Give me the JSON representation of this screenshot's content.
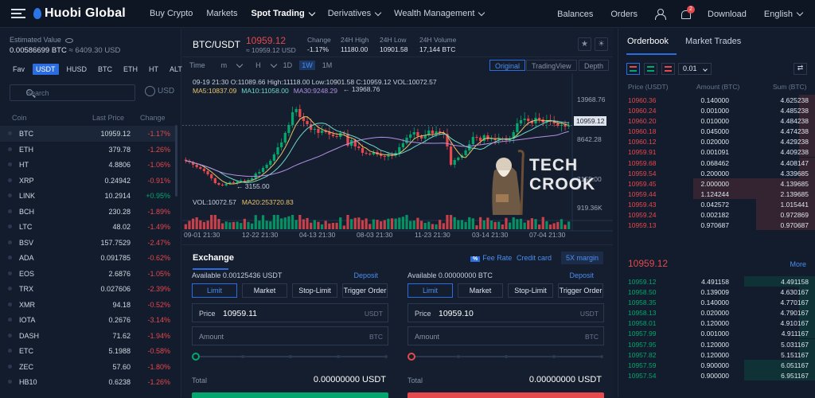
{
  "topnav": {
    "logo": "Huobi Global",
    "items": [
      "Buy Crypto",
      "Markets",
      "Spot Trading",
      "Derivatives",
      "Wealth Management"
    ],
    "active_item": "Spot Trading",
    "right_items": {
      "balances": "Balances",
      "orders": "Orders",
      "download": "Download",
      "language": "English"
    },
    "notification_count": "2"
  },
  "sidebar": {
    "est_label": "Estimated Value",
    "est_btc": "0.00586699 BTC",
    "est_usd": "≈ 6409.30 USD",
    "tabs": [
      "Fav",
      "USDT",
      "HUSD",
      "BTC",
      "ETH",
      "HT",
      "ALTS"
    ],
    "active_tab": "USDT",
    "search_placeholder": "Search",
    "currency_toggle": "USD",
    "columns": {
      "coin": "Coin",
      "last_price": "Last Price",
      "change": "Change"
    },
    "coins": [
      {
        "coin": "BTC",
        "price": "10959.12",
        "change": "-1.17%",
        "dir": "neg"
      },
      {
        "coin": "ETH",
        "price": "379.78",
        "change": "-1.26%",
        "dir": "neg"
      },
      {
        "coin": "HT",
        "price": "4.8806",
        "change": "-1.06%",
        "dir": "neg"
      },
      {
        "coin": "XRP",
        "price": "0.24942",
        "change": "-0.91%",
        "dir": "neg"
      },
      {
        "coin": "LINK",
        "price": "10.2914",
        "change": "+0.95%",
        "dir": "pos"
      },
      {
        "coin": "BCH",
        "price": "230.28",
        "change": "-1.89%",
        "dir": "neg"
      },
      {
        "coin": "LTC",
        "price": "48.02",
        "change": "-1.49%",
        "dir": "neg"
      },
      {
        "coin": "BSV",
        "price": "157.7529",
        "change": "-2.47%",
        "dir": "neg"
      },
      {
        "coin": "ADA",
        "price": "0.091785",
        "change": "-0.62%",
        "dir": "neg"
      },
      {
        "coin": "EOS",
        "price": "2.6876",
        "change": "-1.05%",
        "dir": "neg"
      },
      {
        "coin": "TRX",
        "price": "0.027606",
        "change": "-2.39%",
        "dir": "neg"
      },
      {
        "coin": "XMR",
        "price": "94.18",
        "change": "-0.52%",
        "dir": "neg"
      },
      {
        "coin": "IOTA",
        "price": "0.2676",
        "change": "-3.14%",
        "dir": "neg"
      },
      {
        "coin": "DASH",
        "price": "71.62",
        "change": "-1.94%",
        "dir": "neg"
      },
      {
        "coin": "ETC",
        "price": "5.1988",
        "change": "-0.58%",
        "dir": "neg"
      },
      {
        "coin": "ZEC",
        "price": "57.60",
        "change": "-1.80%",
        "dir": "neg"
      },
      {
        "coin": "HB10",
        "price": "0.6238",
        "change": "-1.26%",
        "dir": "neg"
      }
    ]
  },
  "ticker": {
    "pair": "BTC/USDT",
    "last_price": "10959.12",
    "last_usd": "≈ 10959.12 USD",
    "stats": [
      {
        "label": "Change",
        "value": "-1.17%",
        "dir": "neg"
      },
      {
        "label": "24H High",
        "value": "11180.00",
        "dir": ""
      },
      {
        "label": "24H Low",
        "value": "10901.58",
        "dir": ""
      },
      {
        "label": "24H Volume",
        "value": "17,144 BTC",
        "dir": ""
      }
    ]
  },
  "chart_tools": {
    "intervals": [
      "Time",
      "m",
      "H",
      "1D",
      "1W",
      "1M"
    ],
    "active_interval": "1W",
    "views": [
      "Original",
      "TradingView",
      "Depth"
    ],
    "active_view": "Original"
  },
  "chart_data": {
    "type": "candlestick",
    "info_line": "09-19 21:30   O:11089.66  High:11118.00  Low:10901.58  C:10959.12  VOL:10072.57",
    "ma": [
      {
        "label": "MA5:10837.09",
        "color": "#e9c46a"
      },
      {
        "label": "MA10:11058.00",
        "color": "#6ed8c9"
      },
      {
        "label": "MA30:9248.29",
        "color": "#b48ee0"
      }
    ],
    "vol_info": "VOL:10072.57",
    "vol_ma": "MA20:253720.83",
    "y_ticks": [
      "13968.76",
      "8642.28",
      "3155.00",
      "919.36K"
    ],
    "current_price_label": "10959.12",
    "max_annotation": "13968.76",
    "min_annotation": "3155.00",
    "x_ticks": [
      "09-01 21:30",
      "12-22 21:30",
      "04-13 21:30",
      "08-03 21:30",
      "11-23 21:30",
      "03-14 21:30",
      "07-04 21:30"
    ],
    "close_path": [
      6500,
      6350,
      6000,
      5700,
      5500,
      5200,
      4800,
      4300,
      3700,
      3500,
      3400,
      3600,
      3800,
      3700,
      3900,
      4000,
      3900,
      4100,
      4300,
      4900,
      5100,
      5600,
      6000,
      6500,
      7300,
      8200,
      8800,
      10000,
      11000,
      12600,
      13000,
      12000,
      11500,
      11100,
      10400,
      10500,
      10000,
      10300,
      10100,
      9800,
      9600,
      9500,
      10000,
      9900,
      8400,
      9100,
      8300,
      8100,
      7500,
      7400,
      7300,
      7600,
      7300,
      7100,
      7000,
      7300,
      7200,
      7500,
      8200,
      8700,
      9400,
      9800,
      10100,
      9600,
      9300,
      9700,
      10300,
      9900,
      10200,
      10000,
      9900,
      8300,
      6000,
      6600,
      6900,
      7200,
      7800,
      8600,
      9500,
      9400,
      9000,
      9700,
      9200,
      9300,
      9100,
      9300,
      9200,
      9100,
      9300,
      10100,
      11200,
      11600,
      11800,
      11500,
      11200,
      11900,
      11700,
      11300,
      11600,
      11400,
      11200,
      10900,
      11000,
      10800,
      10950
    ],
    "volume_visible": true
  },
  "watermark": {
    "line1": "TECH",
    "line2": "CROOK"
  },
  "exchange": {
    "title": "Exchange",
    "fee_badge": "%",
    "fee_rate": "Fee Rate",
    "credit_card": "Credit card",
    "margin": "5X margin",
    "order_types": [
      "Limit",
      "Market",
      "Stop-Limit",
      "Trigger Order"
    ],
    "buy": {
      "available": "Available  0.00125436 USDT",
      "deposit": "Deposit",
      "price_label": "Price",
      "price_value": "10959.11",
      "price_unit": "USDT",
      "amount_label": "Amount",
      "amount_unit": "BTC",
      "total_label": "Total",
      "total_value": "0.00000000 USDT",
      "color": "#03a66d"
    },
    "sell": {
      "available": "Available  0.00000000 BTC",
      "deposit": "Deposit",
      "price_label": "Price",
      "price_value": "10959.10",
      "price_unit": "USDT",
      "amount_label": "Amount",
      "amount_unit": "BTC",
      "total_label": "Total",
      "total_value": "0.00000000 USDT",
      "color": "#e5484d"
    }
  },
  "orderbook": {
    "tabs": [
      "Orderbook",
      "Market Trades"
    ],
    "active_tab": "Orderbook",
    "precision": "0.01",
    "columns": {
      "price": "Price (USDT)",
      "amount": "Amount (BTC)",
      "sum": "Sum (BTC)"
    },
    "asks": [
      {
        "price": "10960.36",
        "amount": "0.140000",
        "sum": "4.625238",
        "depth": 0.08
      },
      {
        "price": "10960.24",
        "amount": "0.001000",
        "sum": "4.485238",
        "depth": 0.08
      },
      {
        "price": "10960.20",
        "amount": "0.010000",
        "sum": "4.484238",
        "depth": 0.08
      },
      {
        "price": "10960.18",
        "amount": "0.045000",
        "sum": "4.474238",
        "depth": 0.08
      },
      {
        "price": "10960.12",
        "amount": "0.020000",
        "sum": "4.429238",
        "depth": 0.08
      },
      {
        "price": "10959.91",
        "amount": "0.001091",
        "sum": "4.409238",
        "depth": 0.08
      },
      {
        "price": "10959.68",
        "amount": "0.068462",
        "sum": "4.408147",
        "depth": 0.08
      },
      {
        "price": "10959.54",
        "amount": "0.200000",
        "sum": "4.339685",
        "depth": 0.08
      },
      {
        "price": "10959.45",
        "amount": "2.000000",
        "sum": "4.139685",
        "depth": 0.62
      },
      {
        "price": "10959.44",
        "amount": "1.124244",
        "sum": "2.139685",
        "depth": 0.62
      },
      {
        "price": "10959.43",
        "amount": "0.042572",
        "sum": "1.015441",
        "depth": 0.3
      },
      {
        "price": "10959.24",
        "amount": "0.002182",
        "sum": "0.972869",
        "depth": 0.3
      },
      {
        "price": "10959.13",
        "amount": "0.970687",
        "sum": "0.970687",
        "depth": 0.3
      }
    ],
    "mid_price": "10959.12",
    "more": "More",
    "bids": [
      {
        "price": "10959.12",
        "amount": "4.491158",
        "sum": "4.491158",
        "depth": 0.36
      },
      {
        "price": "10958.50",
        "amount": "0.139009",
        "sum": "4.630167",
        "depth": 0.08
      },
      {
        "price": "10958.35",
        "amount": "0.140000",
        "sum": "4.770167",
        "depth": 0.08
      },
      {
        "price": "10958.13",
        "amount": "0.020000",
        "sum": "4.790167",
        "depth": 0.08
      },
      {
        "price": "10958.01",
        "amount": "0.120000",
        "sum": "4.910167",
        "depth": 0.08
      },
      {
        "price": "10957.99",
        "amount": "0.001000",
        "sum": "4.911167",
        "depth": 0.08
      },
      {
        "price": "10957.95",
        "amount": "0.120000",
        "sum": "5.031167",
        "depth": 0.08
      },
      {
        "price": "10957.82",
        "amount": "0.120000",
        "sum": "5.151167",
        "depth": 0.08
      },
      {
        "price": "10957.59",
        "amount": "0.900000",
        "sum": "6.051167",
        "depth": 0.36
      },
      {
        "price": "10957.54",
        "amount": "0.900000",
        "sum": "6.951167",
        "depth": 0.36
      }
    ]
  }
}
